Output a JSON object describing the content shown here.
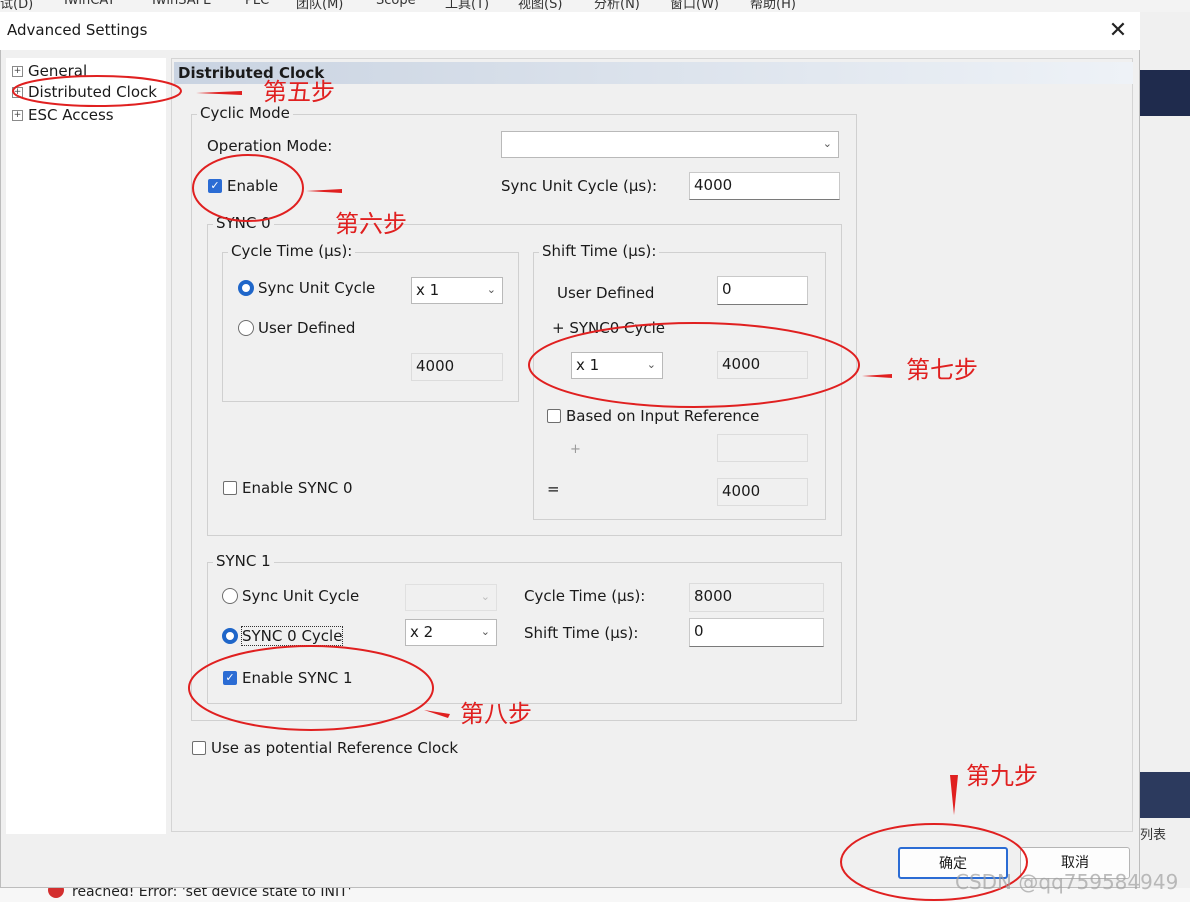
{
  "menubar": {
    "items": [
      "试(D)",
      "TwinCAT",
      "TwinSAFE",
      "PLC",
      "团队(M)",
      "Scope",
      "工具(T)",
      "视图(S)",
      "分析(N)",
      "窗口(W)",
      "帮助(H)"
    ]
  },
  "background": {
    "list_fragment": "列表",
    "status_message": "reached! Error: 'set device state to INIT'"
  },
  "dialog": {
    "title": "Advanced Settings",
    "close_glyph": "✕",
    "tree": [
      {
        "label": "General",
        "expander": "+"
      },
      {
        "label": "Distributed Clock",
        "expander": "+"
      },
      {
        "label": "ESC Access",
        "expander": "+"
      }
    ],
    "panel_title": "Distributed Clock",
    "cyclic_mode": {
      "label": "Cyclic Mode",
      "operation_mode_label": "Operation Mode:",
      "operation_mode_value": "",
      "enable_label": "Enable",
      "enable_checked": true,
      "sync_unit_cycle_label": "Sync Unit Cycle (µs):",
      "sync_unit_cycle_value": "4000"
    },
    "sync0": {
      "label": "SYNC 0",
      "cycle_time": {
        "label": "Cycle Time (µs):",
        "sync_unit_cycle_label": "Sync Unit Cycle",
        "multiplier": "x 1",
        "user_defined_label": "User Defined",
        "value": "4000"
      },
      "shift_time": {
        "label": "Shift Time (µs):",
        "user_defined_label": "User Defined",
        "user_defined_value": "0",
        "sync0_cycle_label": "+ SYNC0 Cycle",
        "multiplier": "x 1",
        "sync0_cycle_value": "4000",
        "input_ref_label": "Based on Input Reference",
        "plus": "+",
        "plus_value": "",
        "equals": "=",
        "total_value": "4000"
      },
      "enable_label": "Enable SYNC 0"
    },
    "sync1": {
      "label": "SYNC 1",
      "sync_unit_cycle_label": "Sync Unit Cycle",
      "sync_unit_multiplier": "",
      "sync0_cycle_label": "SYNC 0 Cycle",
      "sync0_multiplier": "x 2",
      "cycle_time_label": "Cycle Time (µs):",
      "cycle_time_value": "8000",
      "shift_time_label": "Shift Time (µs):",
      "shift_time_value": "0",
      "enable_label": "Enable SYNC 1",
      "enable_checked": true
    },
    "reference_clock_label": "Use as potential Reference Clock",
    "ok_label": "确定",
    "cancel_label": "取消"
  },
  "annotations": {
    "step5": "第五步",
    "step6": "第六步",
    "step7": "第七步",
    "step8": "第八步",
    "step9": "第九步",
    "color": "#e02020"
  },
  "watermark": "CSDN @qq759584949"
}
